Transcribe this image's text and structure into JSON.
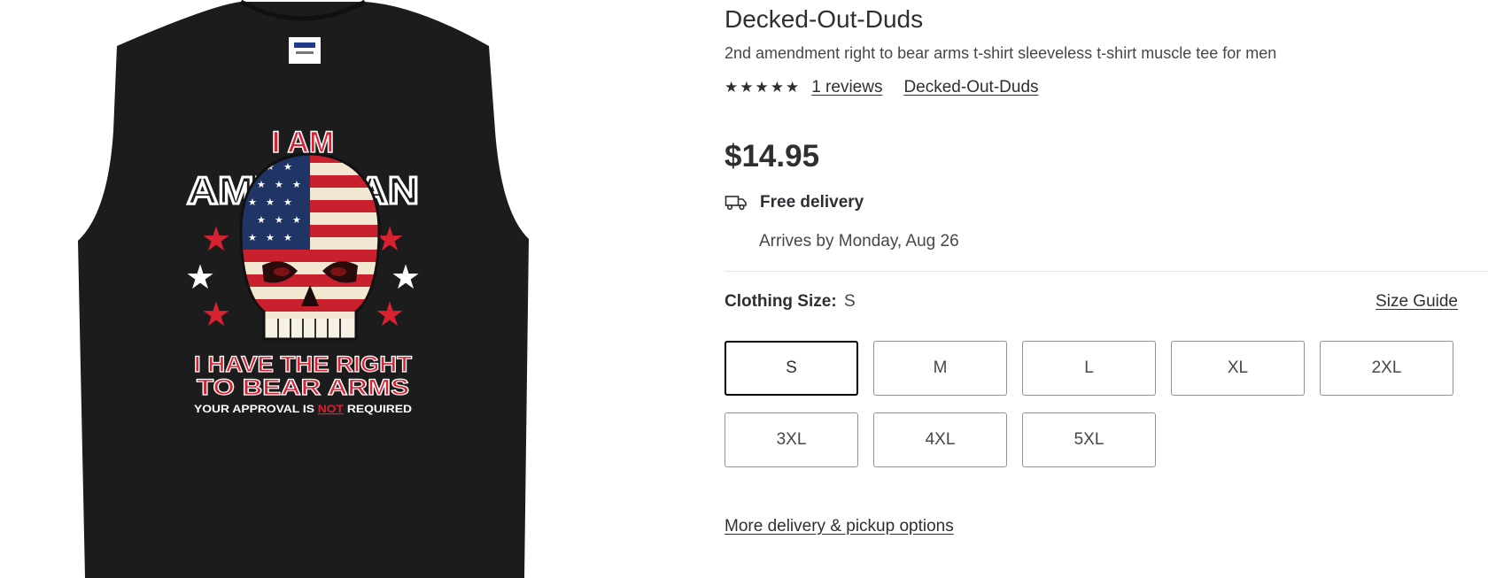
{
  "product": {
    "brand": "Decked-Out-Duds",
    "title": "2nd amendment right to bear arms t-shirt sleeveless t-shirt muscle tee for men",
    "rating_stars": 5,
    "reviews_text": "1 reviews",
    "seller": "Decked-Out-Duds",
    "price": "$14.95"
  },
  "delivery": {
    "icon": "truck-icon",
    "title": "Free delivery",
    "arrival": "Arrives by Monday, Aug 26"
  },
  "sizes": {
    "label": "Clothing Size:",
    "selected": "S",
    "guide": "Size Guide",
    "options": [
      "S",
      "M",
      "L",
      "XL",
      "2XL",
      "3XL",
      "4XL",
      "5XL"
    ]
  },
  "more_options": "More delivery & pickup options",
  "image": {
    "shirt_color": "#1c1c1c",
    "accent_red": "#d92231",
    "print_text": {
      "line1": "I AM",
      "line2": "AMERICAN",
      "line3": "I HAVE THE RIGHT",
      "line4": "TO BEAR ARMS",
      "line5a": "YOUR APPROVAL IS ",
      "line5b": "NOT",
      "line5c": " REQUIRED"
    }
  }
}
